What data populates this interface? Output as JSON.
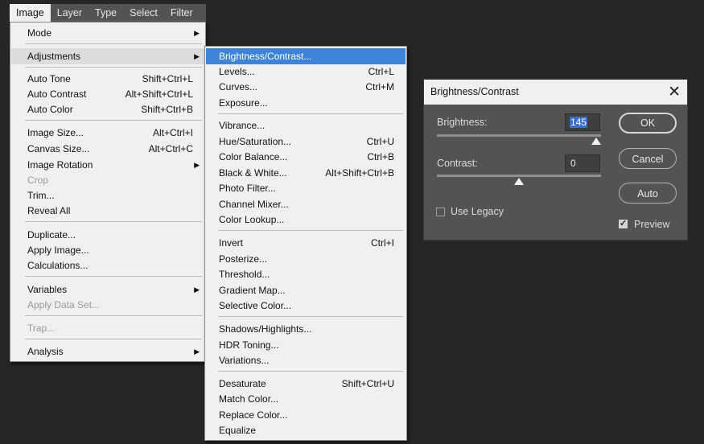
{
  "menubar": {
    "items": [
      "Image",
      "Layer",
      "Type",
      "Select",
      "Filter"
    ]
  },
  "image_menu": {
    "mode": "Mode",
    "adjustments": "Adjustments",
    "auto_tone": "Auto Tone",
    "auto_tone_sc": "Shift+Ctrl+L",
    "auto_contrast": "Auto Contrast",
    "auto_contrast_sc": "Alt+Shift+Ctrl+L",
    "auto_color": "Auto Color",
    "auto_color_sc": "Shift+Ctrl+B",
    "image_size": "Image Size...",
    "image_size_sc": "Alt+Ctrl+I",
    "canvas_size": "Canvas Size...",
    "canvas_size_sc": "Alt+Ctrl+C",
    "image_rotation": "Image Rotation",
    "crop": "Crop",
    "trim": "Trim...",
    "reveal_all": "Reveal All",
    "duplicate": "Duplicate...",
    "apply_image": "Apply Image...",
    "calculations": "Calculations...",
    "variables": "Variables",
    "apply_data_set": "Apply Data Set...",
    "trap": "Trap...",
    "analysis": "Analysis"
  },
  "adjustments_menu": {
    "brightness_contrast": "Brightness/Contrast...",
    "levels": "Levels...",
    "levels_sc": "Ctrl+L",
    "curves": "Curves...",
    "curves_sc": "Ctrl+M",
    "exposure": "Exposure...",
    "vibrance": "Vibrance...",
    "hue_saturation": "Hue/Saturation...",
    "hue_saturation_sc": "Ctrl+U",
    "color_balance": "Color Balance...",
    "color_balance_sc": "Ctrl+B",
    "black_white": "Black & White...",
    "black_white_sc": "Alt+Shift+Ctrl+B",
    "photo_filter": "Photo Filter...",
    "channel_mixer": "Channel Mixer...",
    "color_lookup": "Color Lookup...",
    "invert": "Invert",
    "invert_sc": "Ctrl+I",
    "posterize": "Posterize...",
    "threshold": "Threshold...",
    "gradient_map": "Gradient Map...",
    "selective_color": "Selective Color...",
    "shadows_highlights": "Shadows/Highlights...",
    "hdr_toning": "HDR Toning...",
    "variations": "Variations...",
    "desaturate": "Desaturate",
    "desaturate_sc": "Shift+Ctrl+U",
    "match_color": "Match Color...",
    "replace_color": "Replace Color...",
    "equalize": "Equalize"
  },
  "dialog": {
    "title": "Brightness/Contrast",
    "close_glyph": "✕",
    "brightness_label": "Brightness:",
    "brightness_value": "145",
    "brightness_level": 0.97,
    "contrast_label": "Contrast:",
    "contrast_value": "0",
    "contrast_level": 0.5,
    "ok_label": "OK",
    "cancel_label": "Cancel",
    "auto_label": "Auto",
    "use_legacy_label": "Use Legacy",
    "use_legacy_checked": false,
    "preview_label": "Preview",
    "preview_checked": true
  },
  "icons": {
    "submenu_arrow": "▶",
    "close": "close-icon",
    "slider_thumb": "triangle-thumb"
  },
  "colors": {
    "highlight": "#3d84d8",
    "dialog_bg": "#535353",
    "background": "#262626"
  }
}
